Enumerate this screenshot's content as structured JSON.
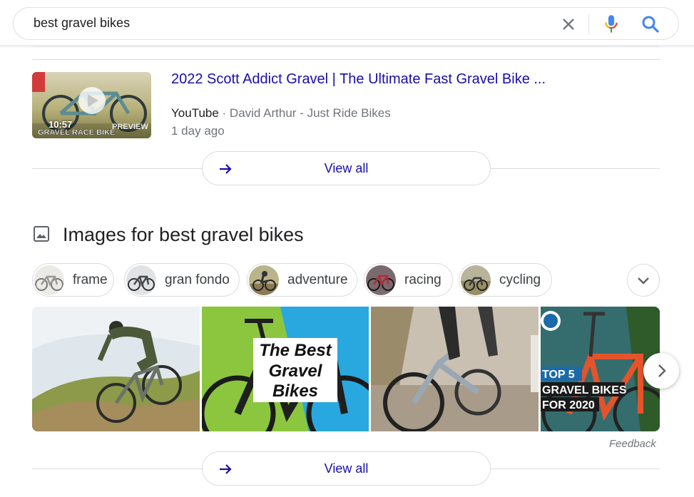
{
  "search": {
    "query": "best gravel bikes"
  },
  "video_result": {
    "title": "2022 Scott Addict Gravel | The Ultimate Fast Gravel Bike ...",
    "source": "YouTube",
    "separator": " · ",
    "channel": "David Arthur - Just Ride Bikes",
    "date": "1 day ago",
    "duration": "10:57"
  },
  "view_all_label": "View all",
  "images_section": {
    "heading": "Images for best gravel bikes",
    "chips": [
      {
        "label": "frame"
      },
      {
        "label": "gran fondo"
      },
      {
        "label": "adventure"
      },
      {
        "label": "racing"
      },
      {
        "label": "cycling"
      }
    ],
    "photo2_text": [
      "The Best",
      "Gravel",
      "Bikes"
    ],
    "photo4_text": [
      "TOP 5",
      "GRAVEL BIKES",
      "FOR 2020"
    ],
    "feedback": "Feedback"
  },
  "colors": {
    "link": "#1a0dab",
    "muted": "#70757a",
    "border": "#dadce0"
  }
}
